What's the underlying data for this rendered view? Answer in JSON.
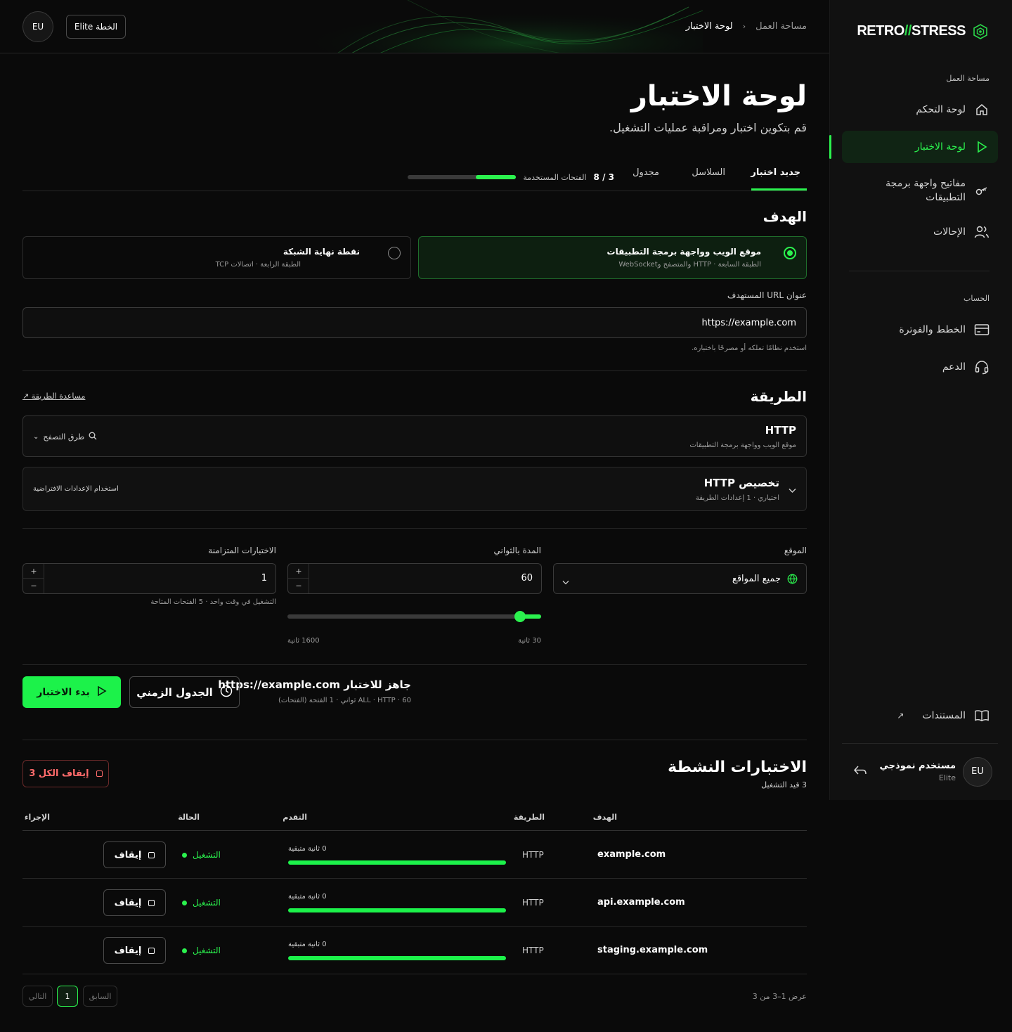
{
  "brand": {
    "part1": "RETRO",
    "slash": "//",
    "part2": "STRESS"
  },
  "topbar": {
    "breadcrumb_root": "مساحة العمل",
    "breadcrumb_current": "لوحة الاختبار",
    "region": "EU",
    "plan_button": "الخطة Elite"
  },
  "sidebar": {
    "section_workspace": "مساحة العمل",
    "items": [
      {
        "label": "لوحة التحكم",
        "icon": "home-icon"
      },
      {
        "label": "لوحة الاختبار",
        "icon": "play-icon",
        "active": true
      },
      {
        "label": "مفاتيح واجهة برمجة التطبيقات",
        "icon": "key-icon"
      },
      {
        "label": "الإحالات",
        "icon": "users-icon"
      }
    ],
    "section_account": "الحساب",
    "account_items": [
      {
        "label": "الخطط والفوترة",
        "icon": "billing-icon"
      },
      {
        "label": "الدعم",
        "icon": "headset-icon"
      }
    ],
    "docs": "المستندات",
    "user": {
      "avatar": "EU",
      "name": "مستخدم نموذجي",
      "plan": "Elite"
    }
  },
  "page": {
    "title": "لوحة الاختبار",
    "subtitle": "قم بتكوين اختبار ومراقبة عمليات التشغيل.",
    "tabs": [
      "جديد اختبار",
      "السلاسل",
      "مجدول"
    ],
    "usage_count": "3 / 8",
    "usage_label": "الفتحات المستخدمة",
    "usage_fraction": 0.375
  },
  "target": {
    "title": "الهدف",
    "options": [
      {
        "title": "موقع الويب وواجهة برمجة التطبيقات",
        "sub": "الطبقة السابعة · HTTP والمتصفح وWebSocket",
        "selected": true
      },
      {
        "title": "نقطة نهاية الشبكة",
        "sub": "الطبقة الرابعة · اتصالات TCP",
        "selected": false
      }
    ],
    "url_label": "عنوان URL المستهدف",
    "url_value": "https://example.com",
    "url_hint": "استخدم نظامًا تملكه أو مصرحًا باختباره."
  },
  "method": {
    "title": "الطريقة",
    "help_link": "مساعدة الطريقة ↗",
    "selected": "HTTP",
    "selected_sub": "موقع الويب وواجهة برمجة التطبيقات",
    "browse": "طرق التصفح",
    "custom_title": "تخصيص HTTP",
    "custom_sub": "اختياري · 1 إعدادات الطريقة",
    "custom_default": "استخدام الإعدادات الافتراضية"
  },
  "params": {
    "location_label": "الموقع",
    "location_value": "جميع المواقع",
    "duration_label": "المدة بالثواني",
    "duration_value": "60",
    "duration_min": "30 ثانية",
    "duration_max": "1600 ثانية",
    "duration_fraction": 0.02,
    "concurrent_label": "الاختبارات المتزامنة",
    "concurrent_value": "1",
    "concurrent_hint": "التشغيل في وقت واحد · 5 الفتحات المتاحة",
    "plus": "+",
    "minus": "−"
  },
  "ready": {
    "title": "جاهز للاختبار https://example.com",
    "sub": "60 · ALL · HTTP ثواني · 1 الفتحة (الفتحات)",
    "schedule_btn": "الجدول الزمني",
    "start_btn": "بدء الاختبار"
  },
  "active": {
    "title": "الاختبارات النشطة",
    "sub": "3 قيد التشغيل",
    "stop_all": "إيقاف الكل 3",
    "headers": [
      "الهدف",
      "الطريقة",
      "التقدم",
      "الحالة",
      "الإجراء"
    ],
    "rows": [
      {
        "target": "example.com",
        "method": "HTTP",
        "progress_label": "0 ثانية متبقية",
        "progress": 1.0,
        "status": "التشغيل",
        "action": "إيقاف"
      },
      {
        "target": "api.example.com",
        "method": "HTTP",
        "progress_label": "0 ثانية متبقية",
        "progress": 1.0,
        "status": "التشغيل",
        "action": "إيقاف"
      },
      {
        "target": "staging.example.com",
        "method": "HTTP",
        "progress_label": "0 ثانية متبقية",
        "progress": 1.0,
        "status": "التشغيل",
        "action": "إيقاف"
      }
    ],
    "showing": "عرض 1–3 من 3",
    "prev": "السابق",
    "page": "1",
    "next": "التالي"
  },
  "colors": {
    "accent": "#2bf24e",
    "bg": "#0a0a0a",
    "danger": "#ff6b6b"
  }
}
